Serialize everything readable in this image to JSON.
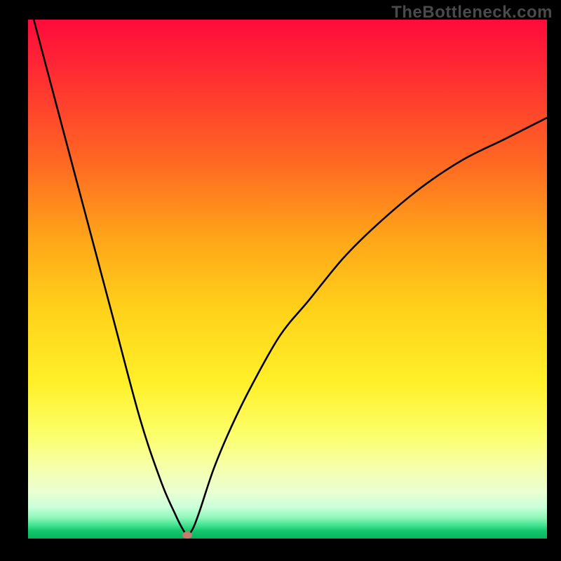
{
  "watermark": "TheBottleneck.com",
  "colors": {
    "frame_bg": "#000000",
    "curve_stroke": "#000000",
    "marker_fill": "#c77a6e",
    "gradient_stops": [
      "#ff0a3c",
      "#ff2b33",
      "#ff6a22",
      "#ffa519",
      "#ffd21a",
      "#fff029",
      "#fcff6a",
      "#f6ffa8",
      "#eaffd2",
      "#c9ffda",
      "#8cf7b8",
      "#3fe28e",
      "#14c76d",
      "#07b45e"
    ]
  },
  "chart_data": {
    "type": "line",
    "title": "",
    "xlabel": "",
    "ylabel": "",
    "xlim": [
      0,
      1
    ],
    "ylim": [
      0,
      1
    ],
    "grid": false,
    "legend": false,
    "notes": "Axes are unlabeled; the plot shows a V-shaped bottleneck curve on a red→green vertical gradient. Coordinates are normalized to the plot area (0..1 in each axis, y increasing upward). Values estimated from pixel positions.",
    "series": [
      {
        "name": "bottleneck-curve",
        "x": [
          0.011,
          0.054,
          0.108,
          0.162,
          0.216,
          0.257,
          0.284,
          0.297,
          0.307,
          0.318,
          0.331,
          0.358,
          0.392,
          0.432,
          0.486,
          0.541,
          0.608,
          0.676,
          0.757,
          0.838,
          0.919,
          1.0
        ],
        "y": [
          1.0,
          0.838,
          0.635,
          0.432,
          0.23,
          0.108,
          0.046,
          0.02,
          0.007,
          0.02,
          0.054,
          0.135,
          0.216,
          0.297,
          0.392,
          0.459,
          0.541,
          0.608,
          0.676,
          0.73,
          0.77,
          0.811
        ]
      }
    ],
    "minimum_point": {
      "x": 0.307,
      "y": 0.007
    }
  }
}
